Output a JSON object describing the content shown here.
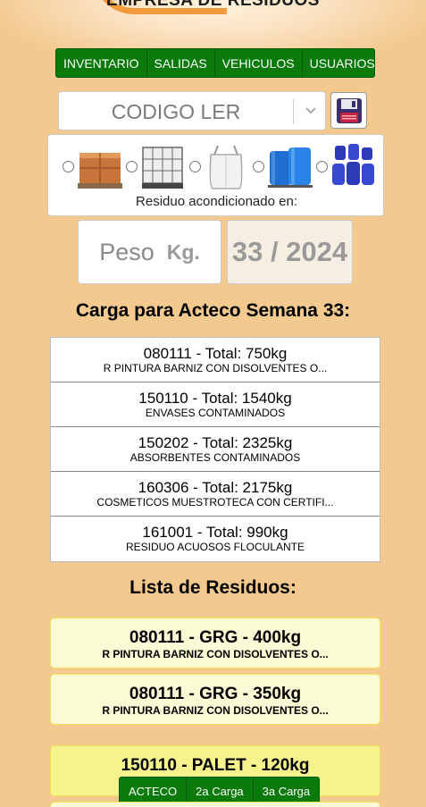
{
  "header": {
    "title": "EMPRESA DE RESIDUOS"
  },
  "nav": {
    "tabs": [
      "INVENTARIO",
      "SALIDAS",
      "VEHICULOS",
      "USUARIOS"
    ]
  },
  "ler_select": {
    "value": "CODIGO LER",
    "icon": "chevron-down-icon"
  },
  "save": {
    "icon": "floppy-disk-icon"
  },
  "packaging": {
    "label": "Residuo acondicionado en:",
    "options": [
      "cardboard-boxes-pallet-icon",
      "ibc-container-icon",
      "big-bag-icon",
      "blue-drums-icon",
      "blue-barrels-icon"
    ]
  },
  "weight": {
    "placeholder": "Peso",
    "unit": "Kg."
  },
  "week": {
    "value": "33 / 2024"
  },
  "summary": {
    "title": "Carga para Acteco Semana 33:",
    "rows": [
      {
        "line1": "080111 - Total: 750kg",
        "line2": "R PINTURA BARNIZ CON DISOLVENTES O..."
      },
      {
        "line1": "150110 - Total: 1540kg",
        "line2": "ENVASES CONTAMINADOS"
      },
      {
        "line1": "150202 - Total: 2325kg",
        "line2": "ABSORBENTES CONTAMINADOS"
      },
      {
        "line1": "160306 - Total: 2175kg",
        "line2": "COSMETICOS MUESTROTECA CON CERTIFI..."
      },
      {
        "line1": "161001 - Total: 990kg",
        "line2": "RESIDUO ACUOSOS FLOCULANTE"
      }
    ]
  },
  "residues": {
    "title": "Lista de Residuos:",
    "items": [
      {
        "line1": "080111 - GRG - 400kg",
        "line2": "R PINTURA BARNIZ CON DISOLVENTES O..."
      },
      {
        "line1": "080111 - GRG - 350kg",
        "line2": "R PINTURA BARNIZ CON DISOLVENTES O..."
      },
      {
        "line1": "150110 - PALET - 120kg",
        "line2": ""
      }
    ],
    "actions": [
      "ACTECO",
      "2a Carga",
      "3a Carga"
    ]
  },
  "colors": {
    "background": "#f3c98f",
    "nav": "#0a7a0a",
    "card": "#fafbd4",
    "card_highlight": "#f7f38c"
  }
}
